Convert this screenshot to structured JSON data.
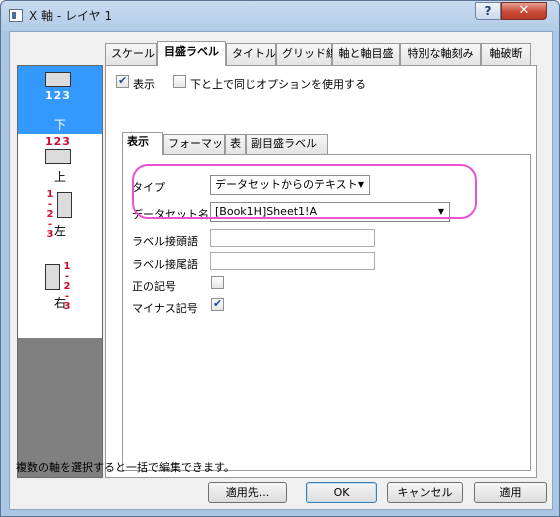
{
  "window": {
    "title": "X 軸 - レイヤ 1",
    "help_label": "?",
    "close_label": "✕"
  },
  "axes_list": [
    {
      "label": "下",
      "selected": true,
      "numbers": "123"
    },
    {
      "label": "上",
      "selected": false,
      "numbers": "123"
    },
    {
      "label": "左",
      "selected": false,
      "numbers": "1-2-3"
    },
    {
      "label": "右",
      "selected": false,
      "numbers": "1-2-3"
    }
  ],
  "main_tabs": [
    "スケール",
    "目盛ラベル",
    "タイトル",
    "グリッド線",
    "軸と軸目盛",
    "特別な軸刻み",
    "軸破断"
  ],
  "active_main_tab": "目盛ラベル",
  "options": {
    "show_label": "表示",
    "show_checked": true,
    "same_options_label": "下と上で同じオプションを使用する",
    "same_options_checked": false
  },
  "sub_tabs": [
    "表示",
    "フォーマット",
    "表",
    "副目盛ラベル"
  ],
  "active_sub_tab": "表示",
  "form": {
    "type_label": "タイプ",
    "type_value": "データセットからのテキスト",
    "dataset_label": "データセット名",
    "dataset_value": "[Book1H]Sheet1!A",
    "prefix_label": "ラベル接頭語",
    "prefix_value": "",
    "suffix_label": "ラベル接尾語",
    "suffix_value": "",
    "plus_sign_label": "正の記号",
    "plus_sign_checked": false,
    "minus_sign_label": "マイナス記号",
    "minus_sign_checked": true
  },
  "status_text": "複数の軸を選択すると一括で編集できます。",
  "buttons": {
    "apply_to": "適用先...",
    "ok": "OK",
    "cancel": "キャンセル",
    "apply": "適用"
  },
  "colors": {
    "highlight": "#ec52d4",
    "selected_item": "#3399ff",
    "axis_number": "#c8102e"
  }
}
